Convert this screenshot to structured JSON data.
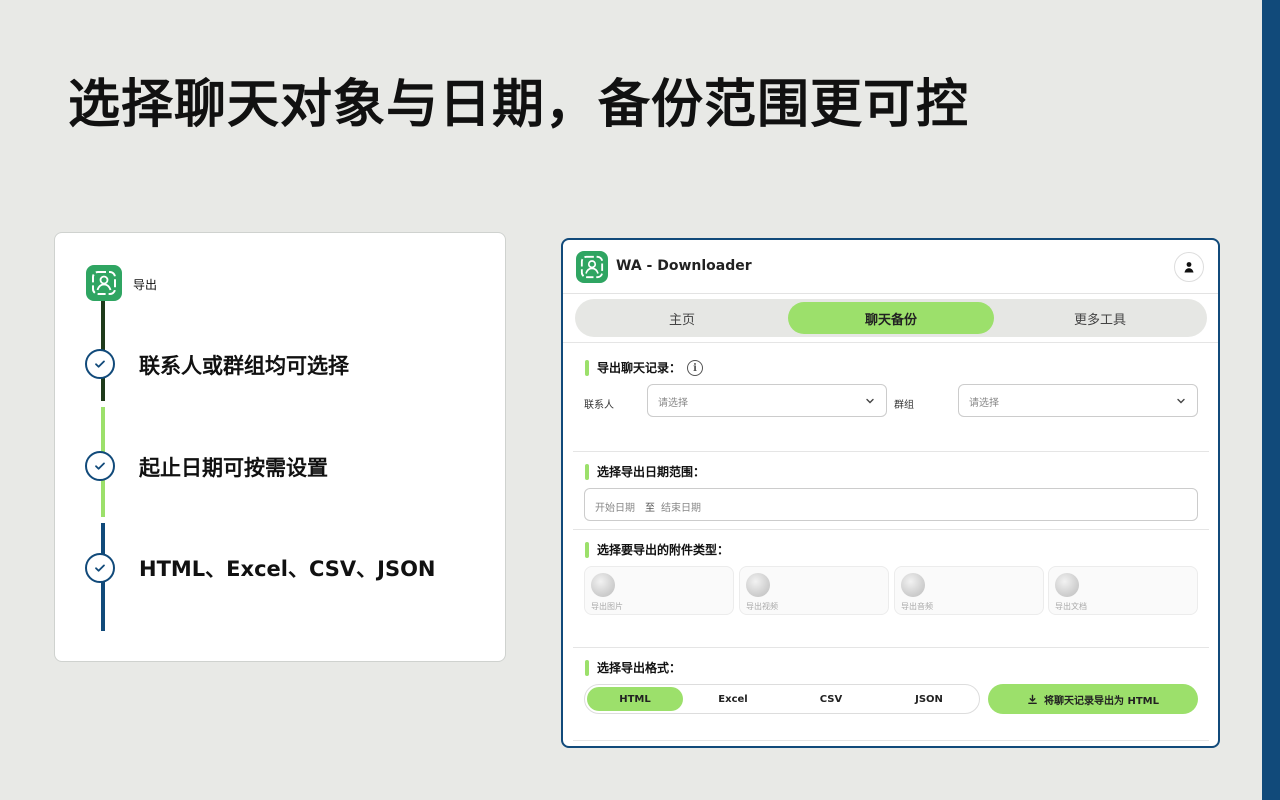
{
  "headline": "选择聊天对象与日期，备份范围更可控",
  "feature_card": {
    "logo_icon": "app-logo-icon",
    "export_label": "导出",
    "features": [
      {
        "text": "联系人或群组均可选择",
        "icon": "check-circle-icon"
      },
      {
        "text": "起止日期可按需设置",
        "icon": "check-circle-icon"
      },
      {
        "text": "HTML、Excel、CSV、JSON",
        "icon": "check-circle-icon"
      }
    ],
    "colors": {
      "dark_green": "#1e3a1a",
      "light_green": "#9ce06b",
      "navy": "#114a7a"
    }
  },
  "app": {
    "title": "WA - Downloader",
    "user_icon": "user-icon",
    "tabs": [
      {
        "label": "主页",
        "active": false
      },
      {
        "label": "聊天备份",
        "active": true
      },
      {
        "label": "更多工具",
        "active": false
      }
    ],
    "export_chat": {
      "title": "导出聊天记录：",
      "contact_label": "联系人",
      "contact_placeholder": "请选择",
      "group_label": "群组",
      "group_placeholder": "请选择"
    },
    "date_range": {
      "title": "选择导出日期范围：",
      "start_placeholder": "开始日期",
      "separator": "至",
      "end_placeholder": "结束日期"
    },
    "attachments": {
      "title": "选择要导出的附件类型：",
      "items": [
        {
          "label": "导出图片",
          "enabled": false
        },
        {
          "label": "导出视频",
          "enabled": false
        },
        {
          "label": "导出音频",
          "enabled": false
        },
        {
          "label": "导出文档",
          "enabled": false
        }
      ]
    },
    "format": {
      "title": "选择导出格式：",
      "options": [
        {
          "label": "HTML",
          "active": true
        },
        {
          "label": "Excel",
          "active": false
        },
        {
          "label": "CSV",
          "active": false
        },
        {
          "label": "JSON",
          "active": false
        }
      ],
      "export_button": "将聊天记录导出为 HTML",
      "export_icon": "download-icon"
    },
    "accent_color": "#9ce06b",
    "border_color": "#114a7a"
  }
}
